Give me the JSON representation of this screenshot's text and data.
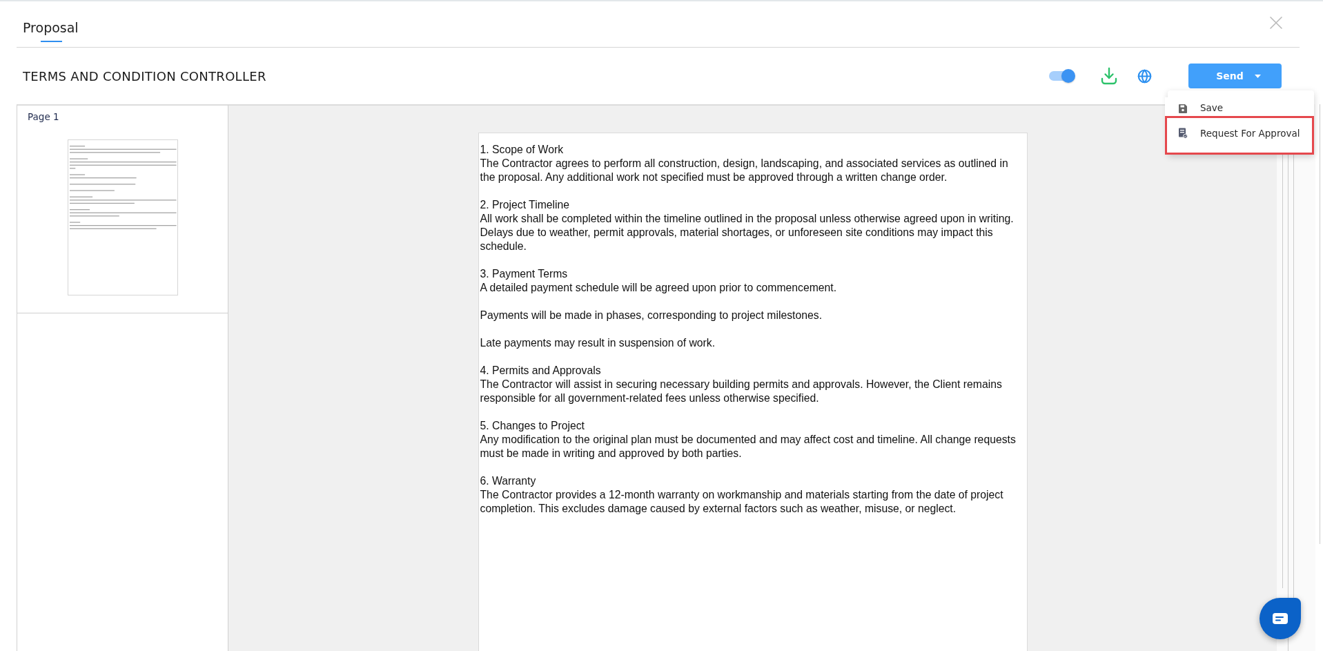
{
  "tabs": [
    {
      "label": "Proposal",
      "selected": true
    }
  ],
  "header": {
    "title": "TERMS AND CONDITION CONTROLLER",
    "toggle": {
      "on": true
    },
    "send_button": {
      "label": "Send"
    }
  },
  "send_menu": {
    "items": [
      {
        "kind": "save",
        "label": "Save",
        "highlighted": false
      },
      {
        "kind": "approval",
        "label": "Request For Approval",
        "highlighted": true
      }
    ]
  },
  "pages": [
    {
      "label": "Page 1"
    }
  ],
  "document": {
    "sections": [
      {
        "heading": "1. Scope of Work",
        "paragraphs": [
          "The Contractor agrees to perform all construction, design, landscaping, and associated services as outlined in the proposal. Any additional work not specified must be approved through a written change order."
        ]
      },
      {
        "heading": "2. Project Timeline",
        "paragraphs": [
          "All work shall be completed within the timeline outlined in the proposal unless otherwise agreed upon in writing. Delays due to weather, permit approvals, material shortages, or unforeseen site conditions may impact this schedule."
        ]
      },
      {
        "heading": "3. Payment Terms",
        "paragraphs": [
          "A detailed payment schedule will be agreed upon prior to commencement.",
          "Payments will be made in phases, corresponding to project milestones.",
          "Late payments may result in suspension of work."
        ]
      },
      {
        "heading": "4. Permits and Approvals",
        "paragraphs": [
          "The Contractor will assist in securing necessary building permits and approvals. However, the Client remains responsible for all government-related fees unless otherwise specified."
        ]
      },
      {
        "heading": "5. Changes to Project",
        "paragraphs": [
          "Any modification to the original plan must be documented and may affect cost and timeline. All change requests must be made in writing and approved by both parties."
        ]
      },
      {
        "heading": "6. Warranty",
        "paragraphs": [
          "The Contractor provides a 12-month warranty on workmanship and materials starting from the date of project completion. This excludes damage caused by external factors such as weather, misuse, or neglect."
        ]
      }
    ]
  }
}
